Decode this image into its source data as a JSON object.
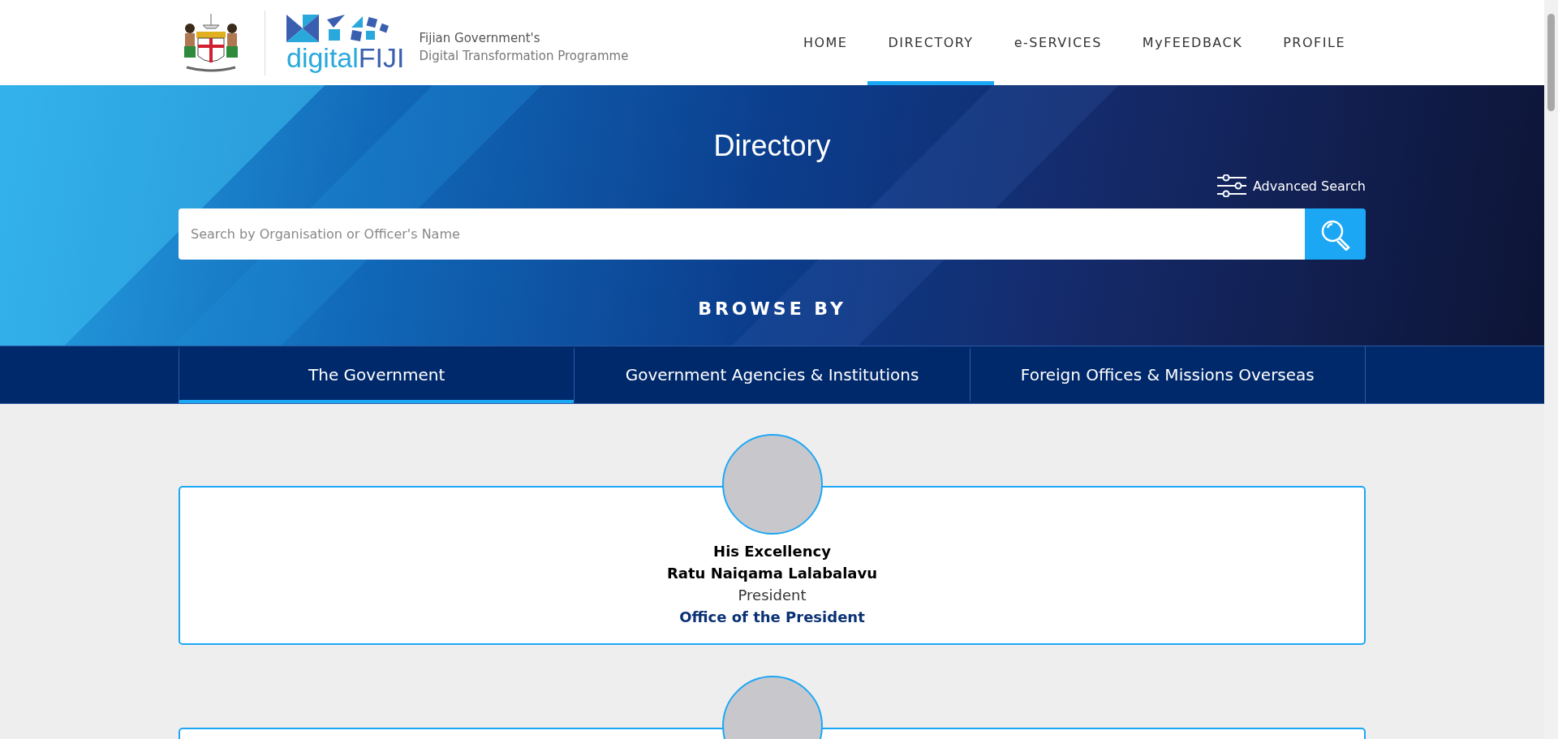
{
  "header": {
    "tagline_1": "Fijian Government's",
    "tagline_2": "Digital Transformation Programme",
    "logo_word_1": "digital",
    "logo_word_2": "FIJI"
  },
  "nav": [
    {
      "label": "HOME",
      "selected": false
    },
    {
      "label": "DIRECTORY",
      "selected": true
    },
    {
      "label": "e-SERVICES",
      "selected": false
    },
    {
      "label": "MyFEEDBACK",
      "selected": false
    },
    {
      "label": "PROFILE",
      "selected": false
    }
  ],
  "hero": {
    "title": "Directory",
    "advanced_search": "Advanced Search",
    "search": {
      "placeholder": "Search by Organisation or Officer's Name"
    },
    "browse_by": "BROWSE BY"
  },
  "tabs": [
    {
      "label": "The Government",
      "selected": true
    },
    {
      "label": "Government Agencies & Institutions",
      "selected": false
    },
    {
      "label": "Foreign Offices & Missions Overseas",
      "selected": false
    }
  ],
  "officials": [
    {
      "kind": "full",
      "honorific": "His Excellency",
      "name": "Ratu Naiqama Lalabalavu",
      "position": "President",
      "office": "Office of the President"
    },
    {
      "kind": "cut"
    }
  ]
}
